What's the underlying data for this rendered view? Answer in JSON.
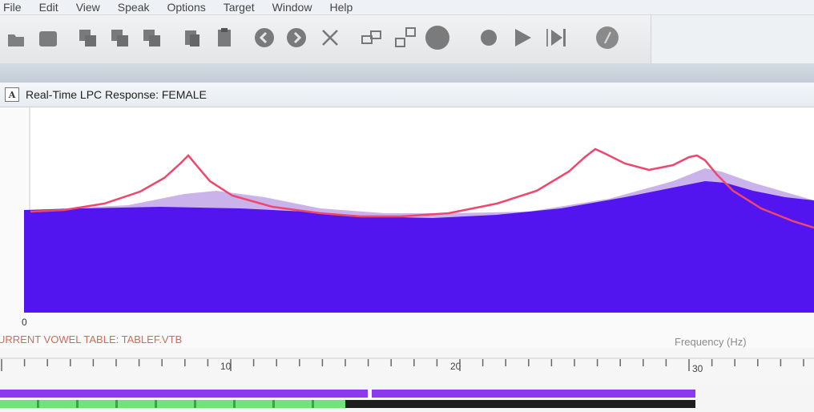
{
  "menu": [
    "File",
    "Edit",
    "View",
    "Speak",
    "Options",
    "Target",
    "Window",
    "Help"
  ],
  "toolbar": {
    "icons": [
      "open-icon",
      "save-icon",
      "copy-stack-icon",
      "paste-stack-icon",
      "duplicate-icon",
      "clipboard-copy-icon",
      "clipboard-paste-icon",
      "previous-icon",
      "next-icon",
      "delete-icon",
      "link-icon",
      "unlink-icon",
      "stop-icon",
      "record-icon",
      "play-icon",
      "play-to-end-icon",
      "help-icon"
    ]
  },
  "window": {
    "system_icon": "A",
    "title": "Real-Time LPC Response: FEMALE"
  },
  "plot": {
    "zero_label": "0",
    "vowel_table": "URRENT VOWEL TABLE: TABLEF.VTB",
    "frequency_label": "Frequency (Hz)",
    "ruler_labels": [
      "10",
      "20",
      "30"
    ],
    "colors": {
      "fill": "#5215f0",
      "lpc_curve": "#f0466e",
      "overlay": "#c9b3ea"
    }
  },
  "progress": {
    "upper_level": 0.855,
    "lower_level": 0.425,
    "upper_color": "#8b3af0",
    "lower_color": "#72e27a"
  }
}
